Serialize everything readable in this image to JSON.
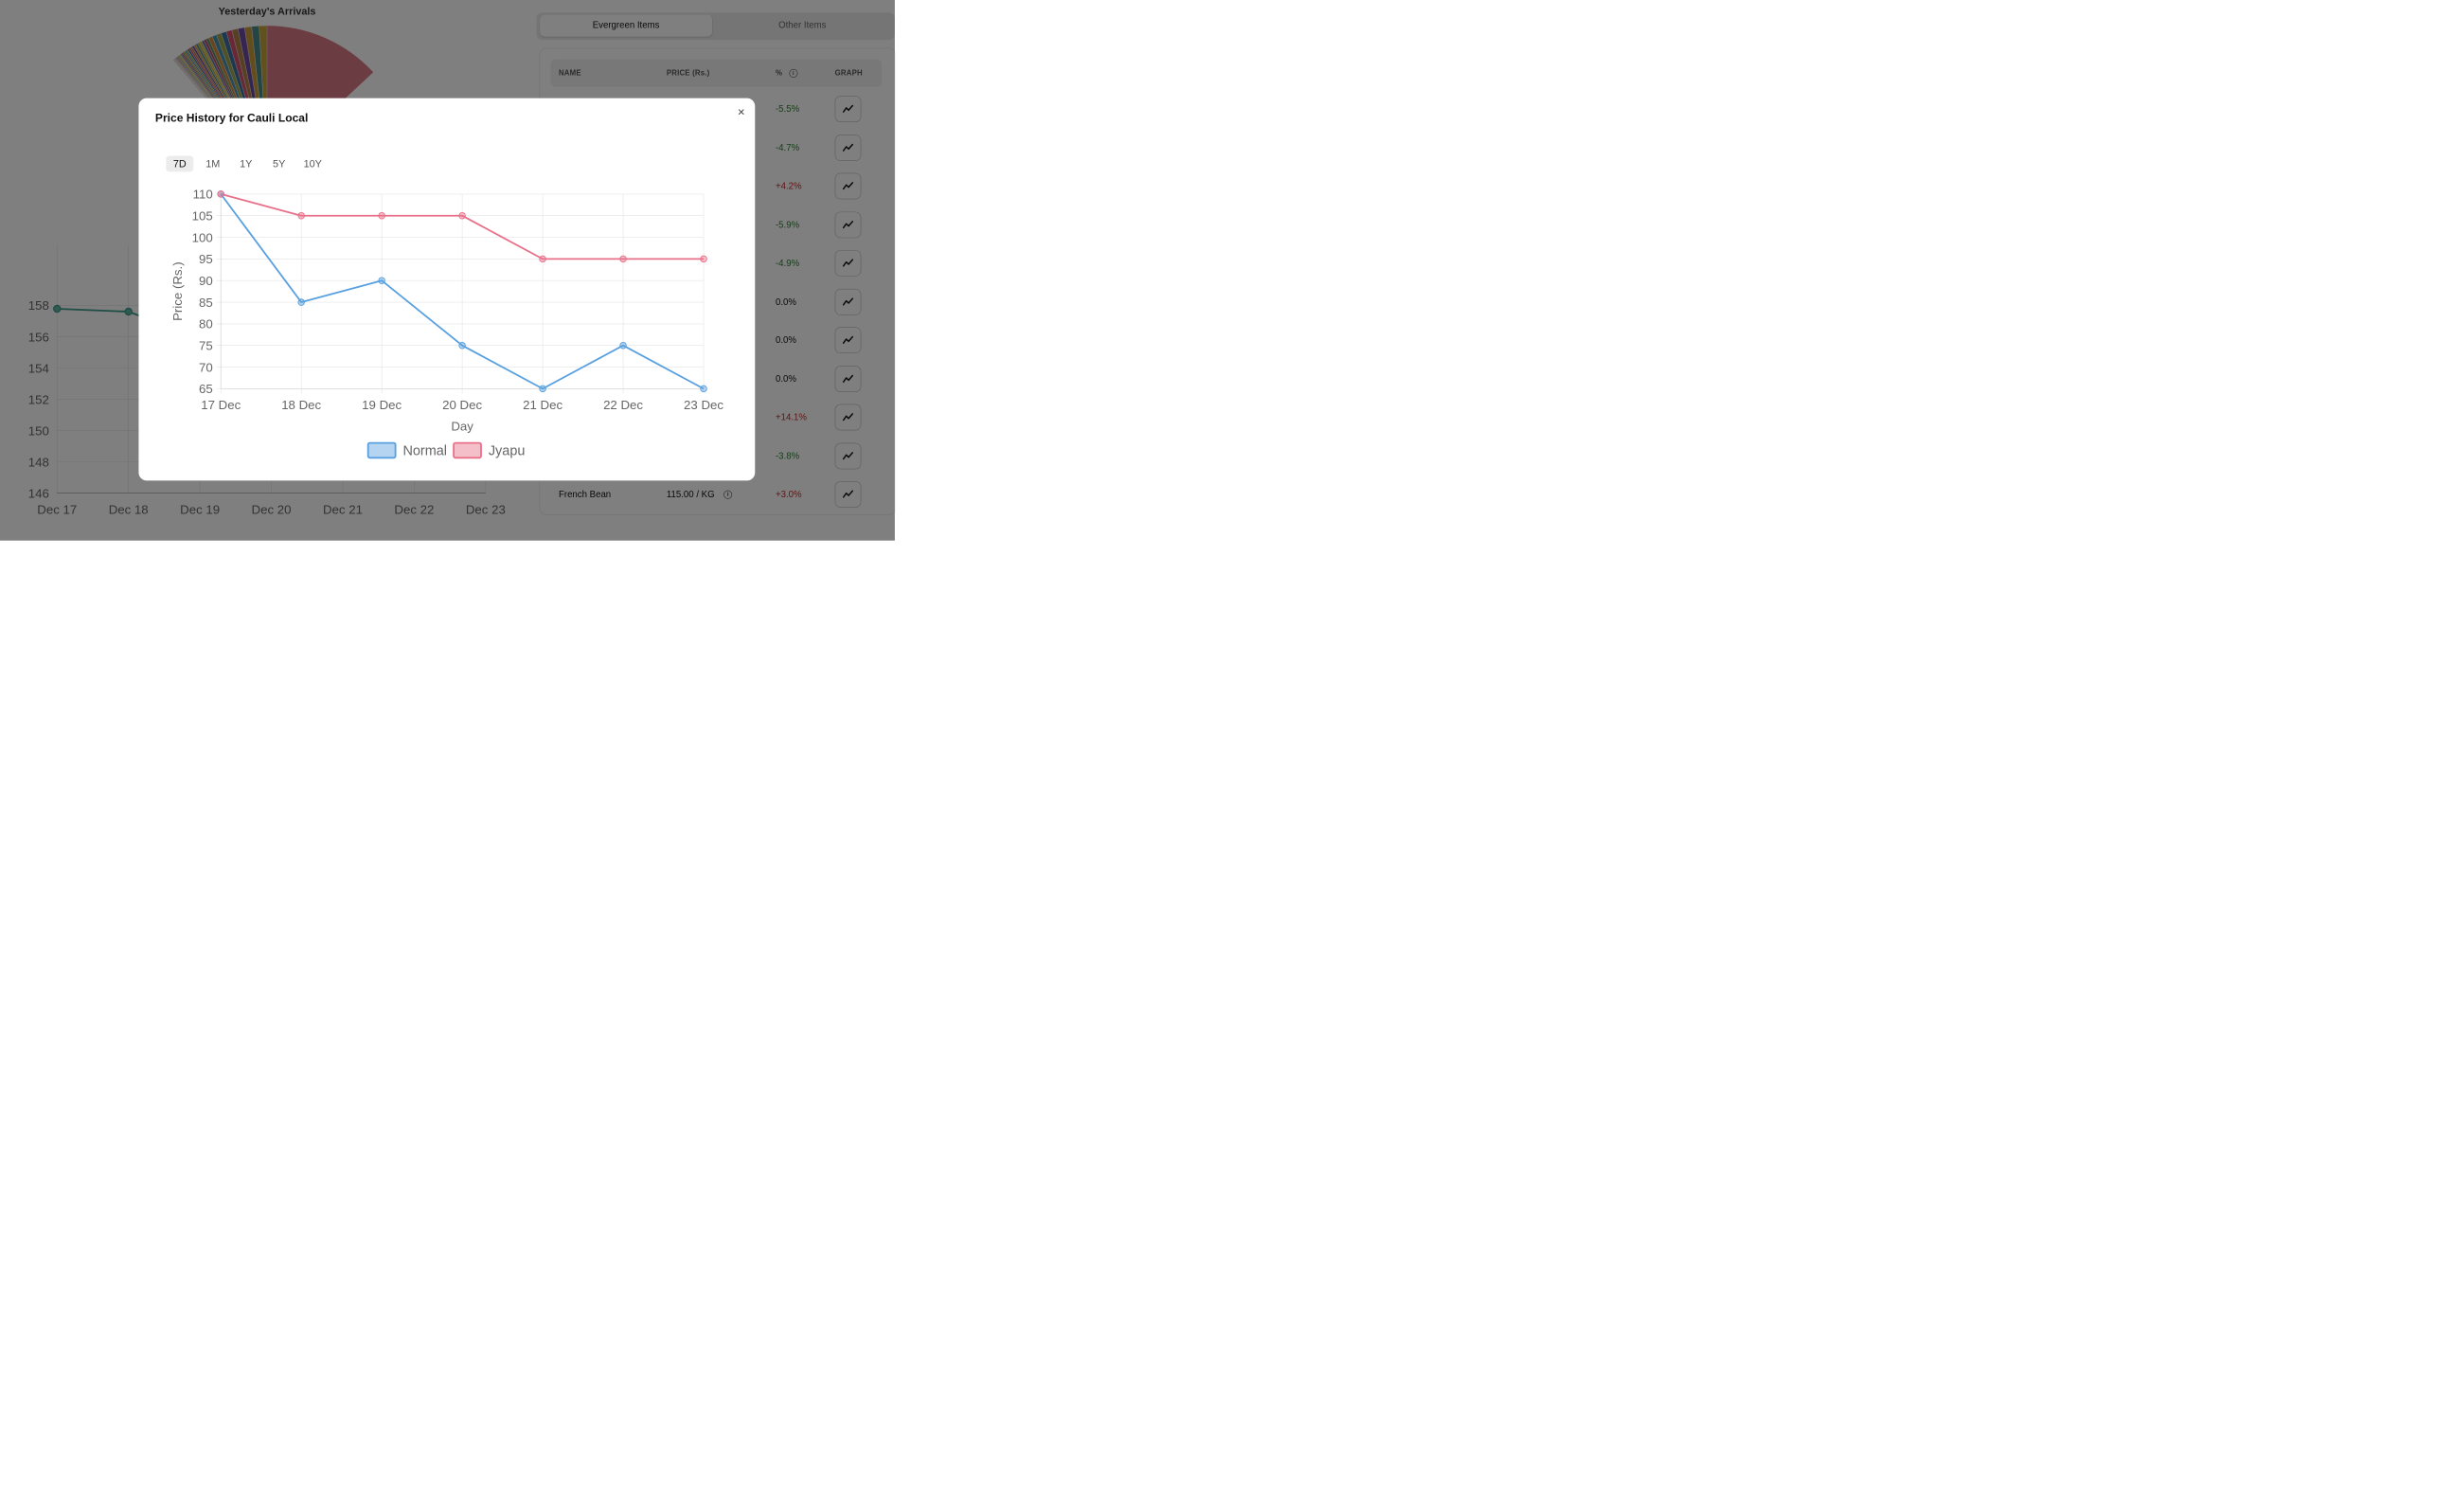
{
  "background": {
    "pie_chart": {
      "title": "Yesterday's Arrivals"
    },
    "line_chart": {
      "y_ticks": [
        "158",
        "156",
        "154",
        "152",
        "150",
        "148",
        "146"
      ],
      "x_ticks": [
        "Dec 17",
        "Dec 18",
        "Dec 19",
        "Dec 20",
        "Dec 21",
        "Dec 22",
        "Dec 23"
      ]
    },
    "tabs": {
      "evergreen": "Evergreen Items",
      "other": "Other Items"
    },
    "table": {
      "headers": {
        "name": "NAME",
        "price": "PRICE (Rs.)",
        "percent": "%",
        "graph": "GRAPH"
      },
      "rows": [
        {
          "name": "",
          "price": "",
          "pct": "-5.5%",
          "trend": "neg"
        },
        {
          "name": "",
          "price": "",
          "pct": "-4.7%",
          "trend": "neg"
        },
        {
          "name": "",
          "price": "",
          "pct": "+4.2%",
          "trend": "pos"
        },
        {
          "name": "",
          "price": "",
          "pct": "-5.9%",
          "trend": "neg"
        },
        {
          "name": "",
          "price": "",
          "pct": "-4.9%",
          "trend": "neg"
        },
        {
          "name": "",
          "price": "",
          "pct": "0.0%",
          "trend": "zero"
        },
        {
          "name": "",
          "price": "",
          "pct": "0.0%",
          "trend": "zero"
        },
        {
          "name": "",
          "price": "",
          "pct": "0.0%",
          "trend": "zero"
        },
        {
          "name": "",
          "price": "",
          "pct": "+14.1%",
          "trend": "pos"
        },
        {
          "name": "",
          "price": "",
          "pct": "-3.8%",
          "trend": "neg"
        },
        {
          "name": "French Bean",
          "price": "115.00 / KG",
          "pct": "+3.0%",
          "trend": "pos"
        }
      ]
    }
  },
  "modal": {
    "title": "Price History for Cauli Local",
    "close_label": "×",
    "range_tabs": [
      "7D",
      "1M",
      "1Y",
      "5Y",
      "10Y"
    ],
    "active_range": "7D"
  },
  "chart_data": {
    "type": "line",
    "title": "",
    "xlabel": "Day",
    "ylabel": "Price (Rs.)",
    "categories": [
      "17 Dec",
      "18 Dec",
      "19 Dec",
      "20 Dec",
      "21 Dec",
      "22 Dec",
      "23 Dec"
    ],
    "ylim": [
      65,
      110
    ],
    "y_ticks": [
      110,
      105,
      100,
      95,
      90,
      85,
      80,
      75,
      70,
      65
    ],
    "grid": true,
    "legend_position": "bottom",
    "series": [
      {
        "name": "Normal",
        "values": [
          110,
          85,
          90,
          75,
          65,
          75,
          65
        ],
        "color": "#58a0e0"
      },
      {
        "name": "Jyapu",
        "values": [
          110,
          105,
          105,
          105,
          95,
          95,
          95
        ],
        "color": "#e9708a"
      }
    ]
  },
  "colors": {
    "overlay": "#808080",
    "normal_line": "#58a0e0",
    "jyapu_line": "#e9708a",
    "negative_pct": "#2e7d32",
    "positive_pct": "#c62828",
    "pie_big_slice": "#d97887"
  }
}
